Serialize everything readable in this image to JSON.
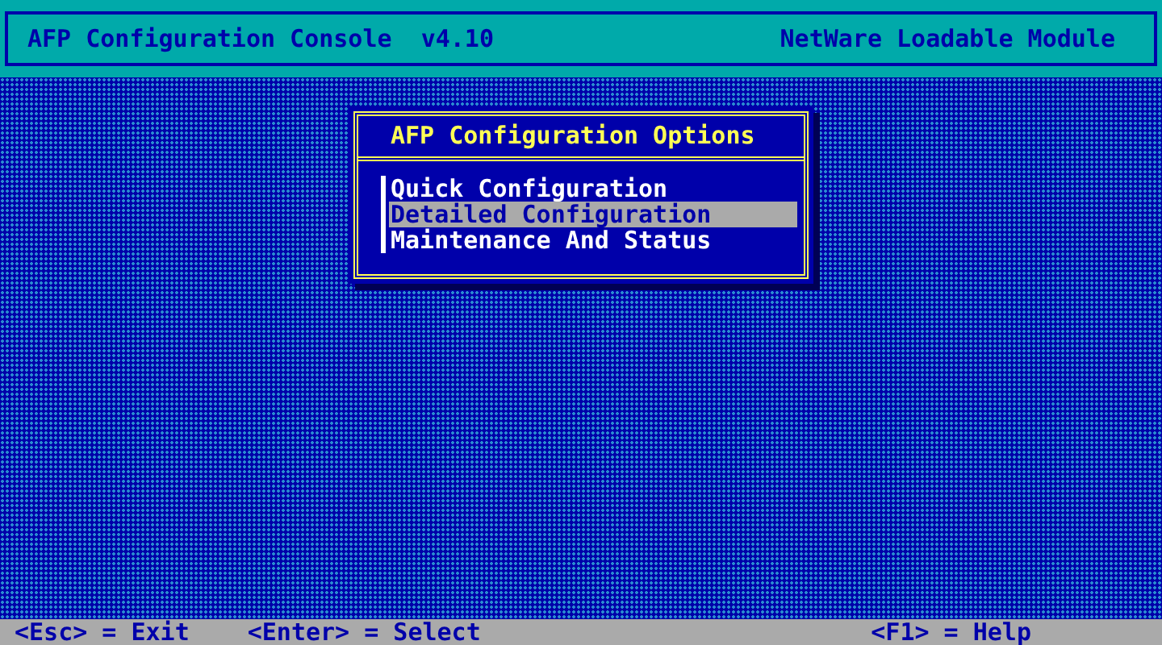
{
  "header": {
    "title": "AFP Configuration Console  v4.10",
    "module": "NetWare Loadable Module"
  },
  "menu": {
    "title": "AFP Configuration Options",
    "items": [
      {
        "label": "Quick Configuration",
        "selected": false
      },
      {
        "label": "Detailed Configuration",
        "selected": true
      },
      {
        "label": "Maintenance And Status",
        "selected": false
      }
    ]
  },
  "status_bar": {
    "left": [
      "<Esc> = Exit",
      "<Enter> = Select"
    ],
    "right": [
      "<F1> = Help"
    ]
  }
}
